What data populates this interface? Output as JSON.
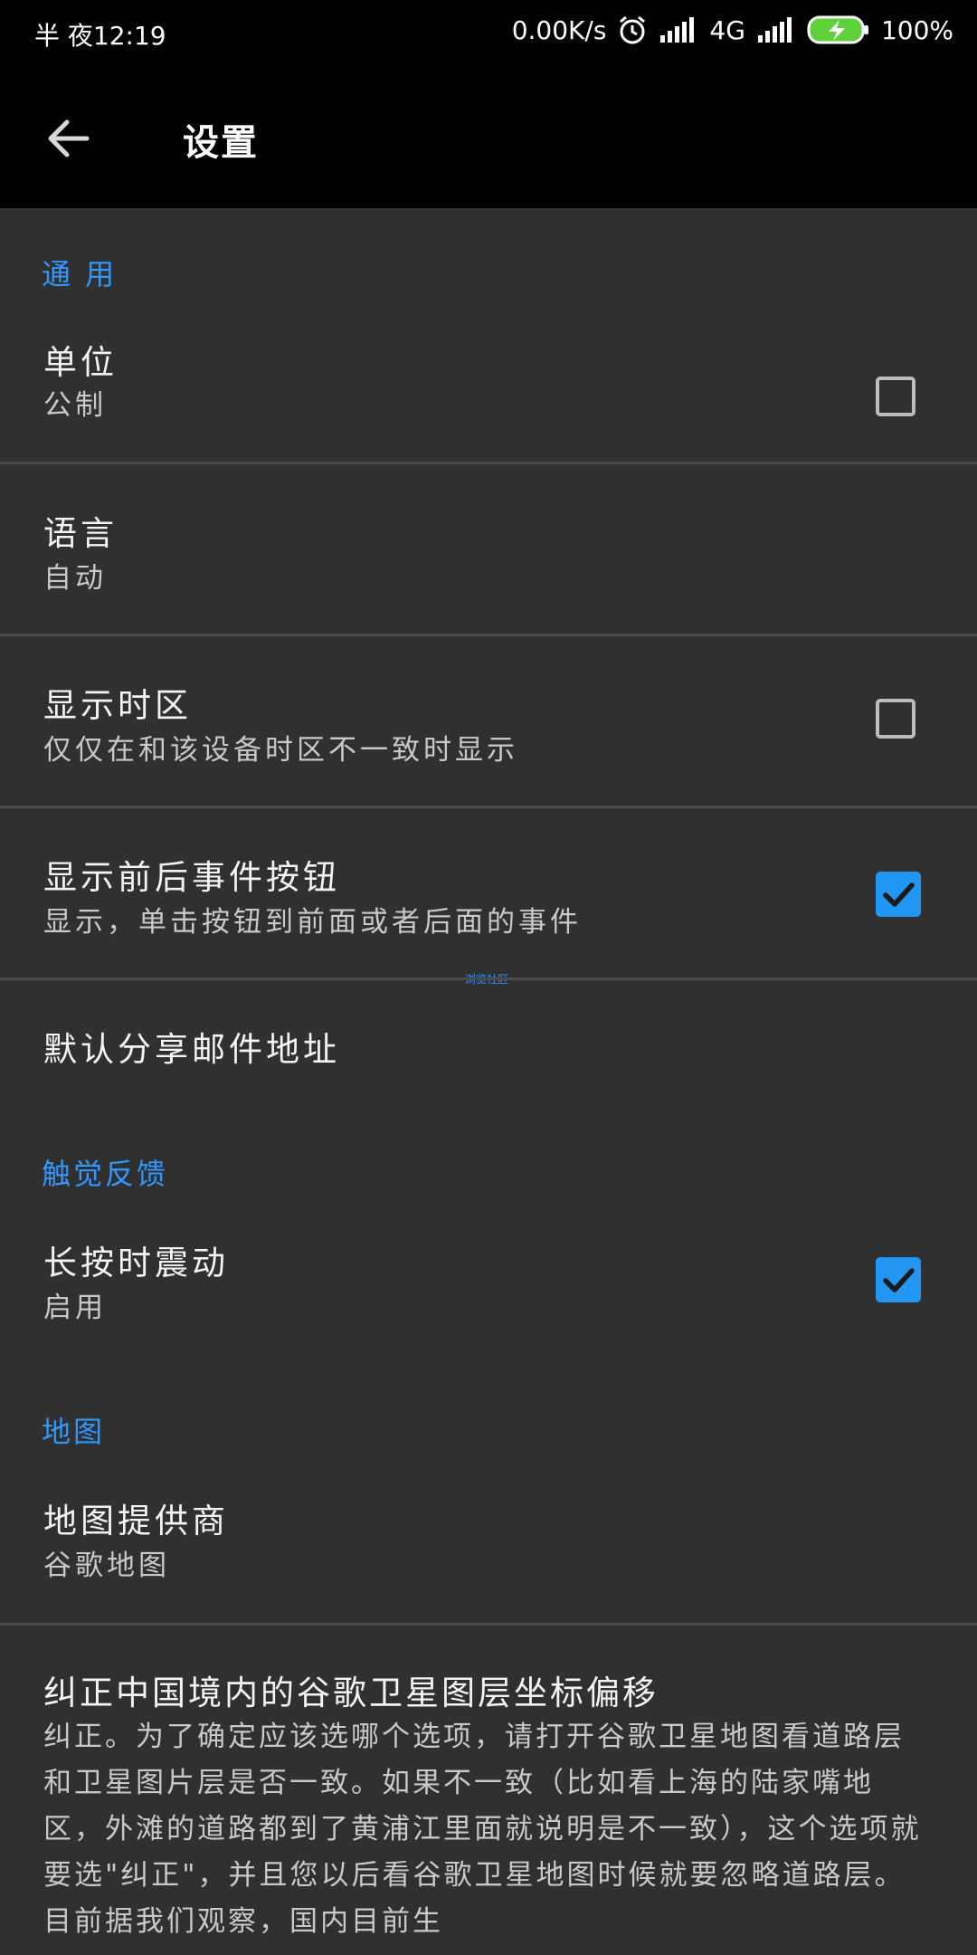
{
  "status_bar": {
    "time": "半 夜12:19",
    "net_speed": "0.00K/s",
    "network": "4G",
    "battery": "100%"
  },
  "app_bar": {
    "title": "设置"
  },
  "sections": {
    "general": "通 用",
    "haptic": "触觉反馈",
    "map": "地图"
  },
  "prefs": {
    "units": {
      "title": "单位",
      "summary": "公制",
      "checked": false
    },
    "language": {
      "title": "语言",
      "summary": "自动"
    },
    "timezone": {
      "title": "显示时区",
      "summary": "仅仅在和该设备时区不一致时显示",
      "checked": false
    },
    "event_buttons": {
      "title": "显示前后事件按钮",
      "summary": "显示，单击按钮到前面或者后面的事件",
      "checked": true
    },
    "share_email": {
      "title": "默认分享邮件地址"
    },
    "vibrate": {
      "title": "长按时震动",
      "summary": "启用",
      "checked": true
    },
    "map_provider": {
      "title": "地图提供商",
      "summary": "谷歌地图"
    },
    "china_offset": {
      "title": "纠正中国境内的谷歌卫星图层坐标偏移",
      "summary": "纠正。为了确定应该选哪个选项，请打开谷歌卫星地图看道路层和卫星图片层是否一致。如果不一致（比如看上海的陆家嘴地区，外滩的道路都到了黄浦江里面就说明是不一致），这个选项就要选\"纠正\"，并且您以后看谷歌卫星地图时候就要忽略道路层。目前据我们观察，国内目前生"
    }
  },
  "watermark": "浏览社区",
  "colors": {
    "accent": "#2f97ff",
    "checkbox_checked": "#2196f3",
    "background": "#303030",
    "bar": "#000000"
  }
}
